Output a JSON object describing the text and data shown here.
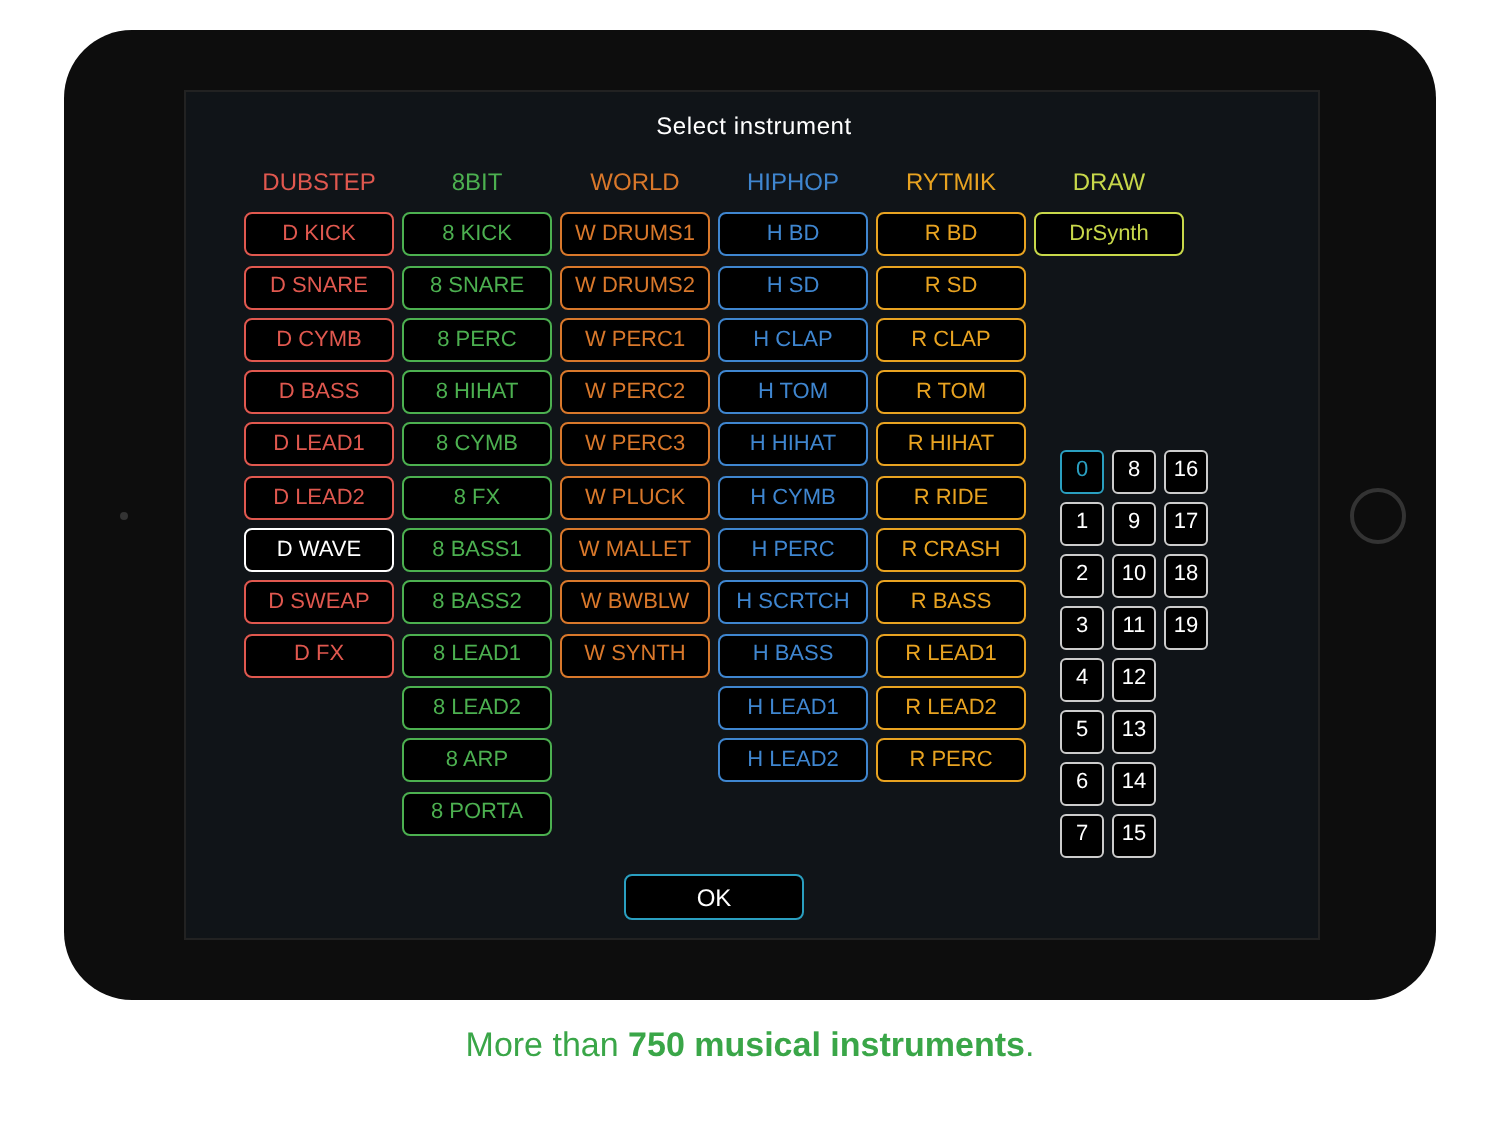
{
  "dialog": {
    "title": "Select instrument",
    "groups": [
      {
        "name": "DUBSTEP",
        "color": "#e0584f",
        "items": [
          {
            "label": "D KICK",
            "selected": false
          },
          {
            "label": "D SNARE",
            "selected": false
          },
          {
            "label": "D CYMB",
            "selected": false
          },
          {
            "label": "D BASS",
            "selected": false
          },
          {
            "label": "D LEAD1",
            "selected": false
          },
          {
            "label": "D LEAD2",
            "selected": false
          },
          {
            "label": "D WAVE",
            "selected": true
          },
          {
            "label": "D SWEAP",
            "selected": false
          },
          {
            "label": "D FX",
            "selected": false
          }
        ]
      },
      {
        "name": "8BIT",
        "color": "#4cb050",
        "items": [
          {
            "label": "8 KICK",
            "selected": false
          },
          {
            "label": "8 SNARE",
            "selected": false
          },
          {
            "label": "8 PERC",
            "selected": false
          },
          {
            "label": "8 HIHAT",
            "selected": false
          },
          {
            "label": "8 CYMB",
            "selected": false
          },
          {
            "label": "8 FX",
            "selected": false
          },
          {
            "label": "8 BASS1",
            "selected": false
          },
          {
            "label": "8 BASS2",
            "selected": false
          },
          {
            "label": "8 LEAD1",
            "selected": false
          },
          {
            "label": "8 LEAD2",
            "selected": false
          },
          {
            "label": "8 ARP",
            "selected": false
          },
          {
            "label": "8 PORTA",
            "selected": false
          }
        ]
      },
      {
        "name": "WORLD",
        "color": "#d9782b",
        "items": [
          {
            "label": "W DRUMS1",
            "selected": false
          },
          {
            "label": "W DRUMS2",
            "selected": false
          },
          {
            "label": "W PERC1",
            "selected": false
          },
          {
            "label": "W PERC2",
            "selected": false
          },
          {
            "label": "W PERC3",
            "selected": false
          },
          {
            "label": "W PLUCK",
            "selected": false
          },
          {
            "label": "W MALLET",
            "selected": false
          },
          {
            "label": "W BWBLW",
            "selected": false
          },
          {
            "label": "W SYNTH",
            "selected": false
          }
        ]
      },
      {
        "name": "HIPHOP",
        "color": "#3f86d0",
        "items": [
          {
            "label": "H BD",
            "selected": false
          },
          {
            "label": "H SD",
            "selected": false
          },
          {
            "label": "H CLAP",
            "selected": false
          },
          {
            "label": "H TOM",
            "selected": false
          },
          {
            "label": "H HIHAT",
            "selected": false
          },
          {
            "label": "H CYMB",
            "selected": false
          },
          {
            "label": "H PERC",
            "selected": false
          },
          {
            "label": "H SCRTCH",
            "selected": false
          },
          {
            "label": "H BASS",
            "selected": false
          },
          {
            "label": "H LEAD1",
            "selected": false
          },
          {
            "label": "H LEAD2",
            "selected": false
          }
        ]
      },
      {
        "name": "RYTMIK",
        "color": "#e8a321",
        "items": [
          {
            "label": "R BD",
            "selected": false
          },
          {
            "label": "R SD",
            "selected": false
          },
          {
            "label": "R CLAP",
            "selected": false
          },
          {
            "label": "R TOM",
            "selected": false
          },
          {
            "label": "R HIHAT",
            "selected": false
          },
          {
            "label": "R RIDE",
            "selected": false
          },
          {
            "label": "R CRASH",
            "selected": false
          },
          {
            "label": "R BASS",
            "selected": false
          },
          {
            "label": "R LEAD1",
            "selected": false
          },
          {
            "label": "R LEAD2",
            "selected": false
          },
          {
            "label": "R PERC",
            "selected": false
          }
        ]
      },
      {
        "name": "DRAW",
        "color": "#c8d84a",
        "items": [
          {
            "label": "DrSynth",
            "selected": false
          }
        ]
      }
    ],
    "slots": [
      {
        "label": "0",
        "selected": true
      },
      {
        "label": "1",
        "selected": false
      },
      {
        "label": "2",
        "selected": false
      },
      {
        "label": "3",
        "selected": false
      },
      {
        "label": "4",
        "selected": false
      },
      {
        "label": "5",
        "selected": false
      },
      {
        "label": "6",
        "selected": false
      },
      {
        "label": "7",
        "selected": false
      },
      {
        "label": "8",
        "selected": false
      },
      {
        "label": "9",
        "selected": false
      },
      {
        "label": "10",
        "selected": false
      },
      {
        "label": "11",
        "selected": false
      },
      {
        "label": "12",
        "selected": false
      },
      {
        "label": "13",
        "selected": false
      },
      {
        "label": "14",
        "selected": false
      },
      {
        "label": "15",
        "selected": false
      },
      {
        "label": "16",
        "selected": false
      },
      {
        "label": "17",
        "selected": false
      },
      {
        "label": "18",
        "selected": false
      },
      {
        "label": "19",
        "selected": false
      }
    ],
    "ok_button": "OK"
  },
  "caption": "More than **750 musical instruments**."
}
